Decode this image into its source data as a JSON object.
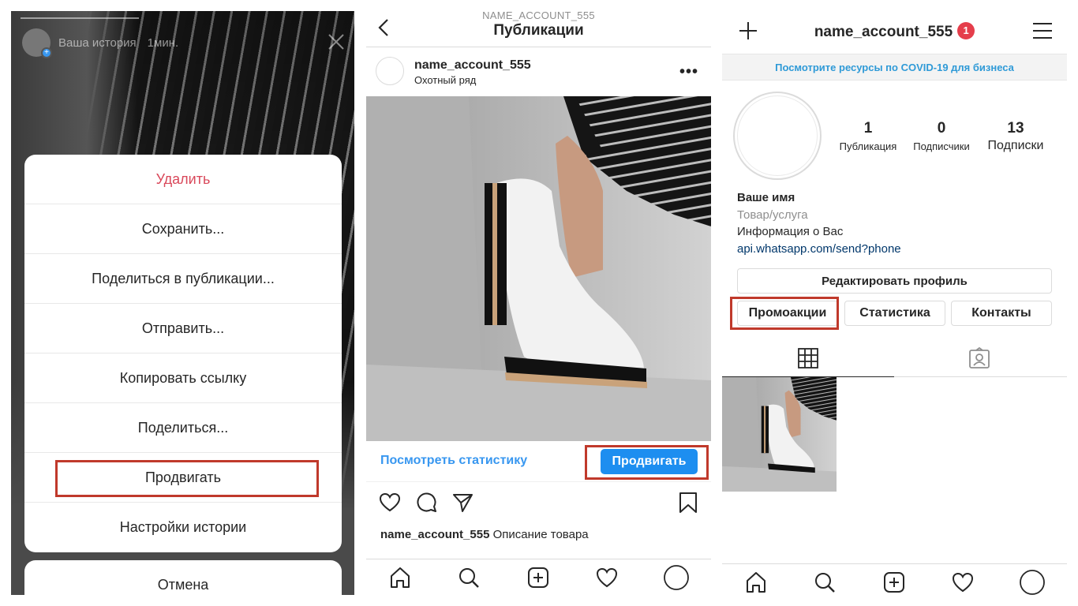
{
  "story": {
    "author": "Ваша история",
    "time": "1мин.",
    "menu": [
      "Удалить",
      "Сохранить...",
      "Поделиться в публикации...",
      "Отправить...",
      "Копировать ссылку",
      "Поделиться...",
      "Продвигать",
      "Настройки истории"
    ],
    "cancel": "Отмена"
  },
  "post": {
    "header_sub": "NAME_ACCOUNT_555",
    "header_title": "Публикации",
    "username": "name_account_555",
    "location": "Охотный ряд",
    "stats_link": "Посмотреть статистику",
    "promote_label": "Продвигать",
    "caption_user": "name_account_555",
    "caption_text": "Описание товара"
  },
  "profile": {
    "username": "name_account_555",
    "notification_count": "1",
    "covid_banner": "Посмотрите ресурсы по COVID-19 для бизнеса",
    "stats": [
      {
        "value": "1",
        "label": "Публикация"
      },
      {
        "value": "0",
        "label": "Подписчики"
      },
      {
        "value": "13",
        "label": "Подписки"
      }
    ],
    "name": "Ваше имя",
    "category": "Товар/услуга",
    "bio": "Информация о Вас",
    "link": "api.whatsapp.com/send?phone",
    "edit_profile": "Редактировать профиль",
    "buttons": [
      "Промоакции",
      "Статистика",
      "Контакты"
    ]
  },
  "colors": {
    "accent_blue": "#1d8ef0",
    "link_blue": "#3897f0",
    "delete_red": "#d9485a",
    "highlight_red": "#c0392b",
    "badge_red": "#e53e4b"
  },
  "icons": [
    "close-icon",
    "back-chevron-icon",
    "more-icon",
    "heart-icon",
    "comment-icon",
    "share-icon",
    "bookmark-icon",
    "home-icon",
    "search-icon",
    "add-icon",
    "activity-heart-icon",
    "profile-icon",
    "plus-icon",
    "hamburger-menu-icon",
    "grid-icon",
    "tagged-icon"
  ]
}
